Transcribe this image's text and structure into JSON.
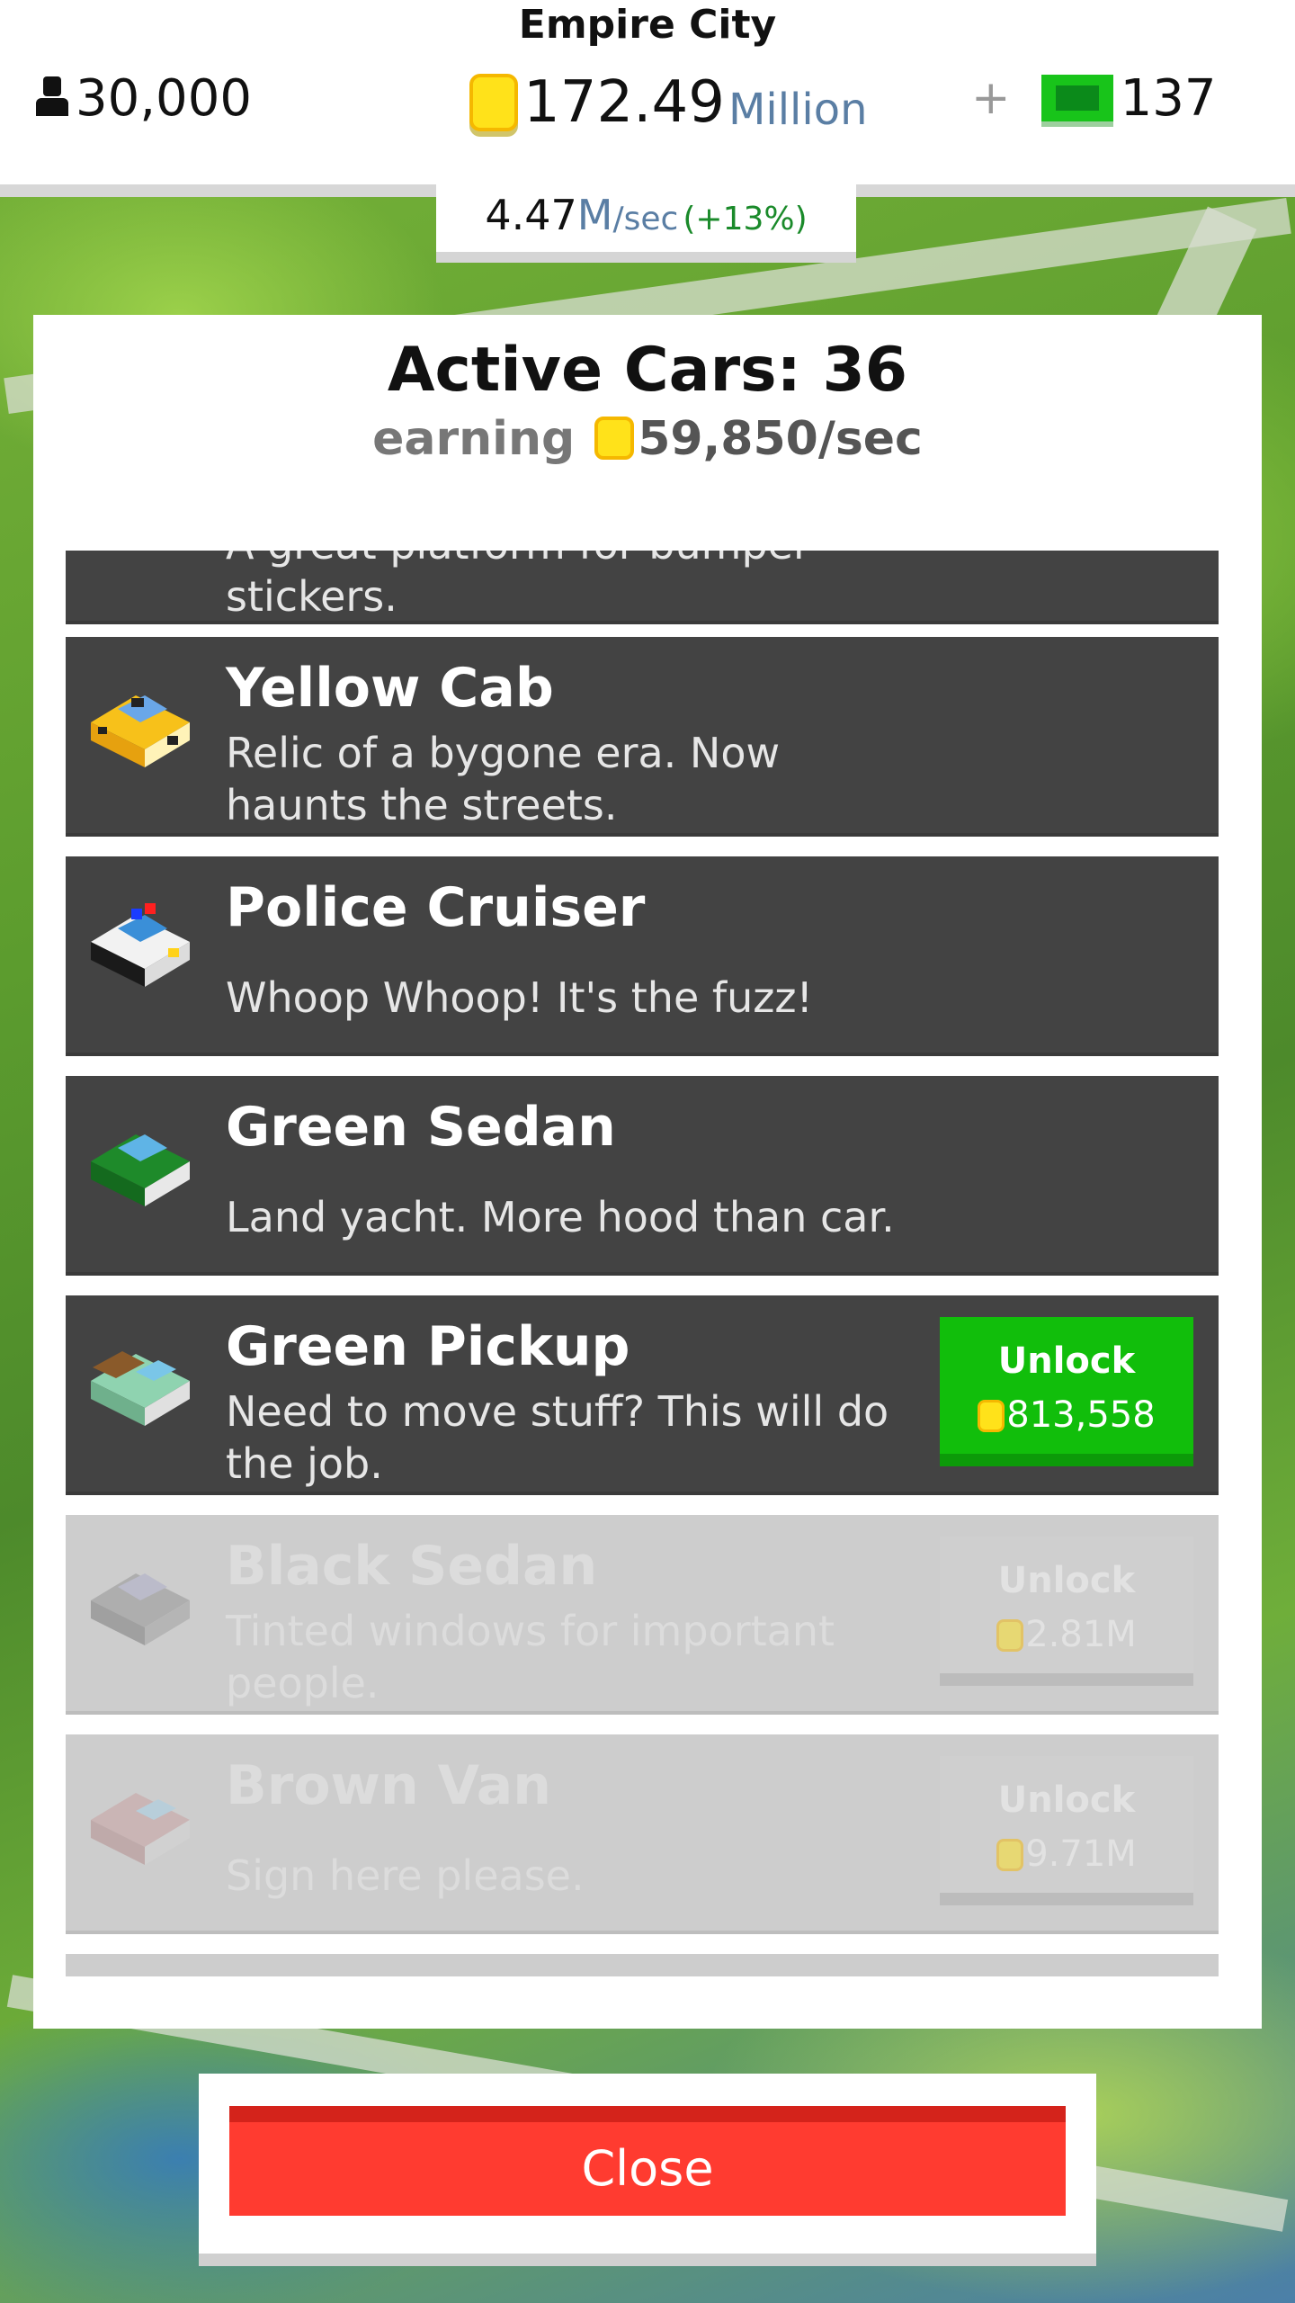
{
  "header": {
    "city_name": "Empire City",
    "population": "30,000",
    "money_value": "172.49",
    "money_unit": "Million",
    "cash_plus": "+",
    "cash_value": "137",
    "rate_value": "4.47",
    "rate_unit_m": "M",
    "rate_unit_sec": "/sec",
    "rate_bonus": "(+13%)"
  },
  "panel": {
    "title": "Active Cars: 36",
    "earning_label": "earning",
    "earning_value": "59,850/sec"
  },
  "cars": [
    {
      "name": "",
      "desc": "A great platform for bumper stickers.",
      "state": "active"
    },
    {
      "name": "Yellow Cab",
      "desc": "Relic of a bygone era. Now haunts the streets.",
      "state": "active",
      "icon": "yellow-cab-icon"
    },
    {
      "name": "Police Cruiser",
      "desc": "Whoop Whoop! It's the fuzz!",
      "state": "active",
      "icon": "police-cruiser-icon"
    },
    {
      "name": "Green Sedan",
      "desc": "Land yacht. More hood than car.",
      "state": "active",
      "icon": "green-sedan-icon"
    },
    {
      "name": "Green Pickup",
      "desc": "Need to move stuff? This will do the job.",
      "state": "unlockable",
      "icon": "green-pickup-icon",
      "unlock_label": "Unlock",
      "unlock_cost": "813,558"
    },
    {
      "name": "Black Sedan",
      "desc": "Tinted windows for important people.",
      "state": "locked",
      "icon": "black-sedan-icon",
      "unlock_label": "Unlock",
      "unlock_cost": "2.81M"
    },
    {
      "name": "Brown Van",
      "desc": "Sign here please.",
      "state": "locked",
      "icon": "brown-van-icon",
      "unlock_label": "Unlock",
      "unlock_cost": "9.71M"
    }
  ],
  "close_label": "Close",
  "colors": {
    "unlock_green": "#11be0b",
    "close_red": "#ff3b30",
    "row_dark": "#434343",
    "row_locked": "#cdcdcd",
    "coin_yellow": "#ffe21a"
  }
}
